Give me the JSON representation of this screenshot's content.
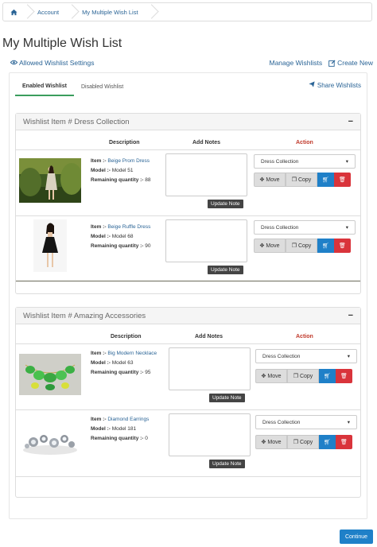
{
  "breadcrumb": {
    "items": [
      "Account",
      "My Multiple Wish List"
    ]
  },
  "page_title": "My Multiple Wish List",
  "settings_link": "Allowed Wishlist Settings",
  "top_links": {
    "manage": "Manage Wishlists",
    "create": "Create New"
  },
  "tabs": [
    {
      "label": "Enabled Wishlist",
      "active": true
    },
    {
      "label": "Disabled Wishlist",
      "active": false
    }
  ],
  "share_label": "Share Wishlists",
  "panels": [
    {
      "title": "Wishlist Item # Dress Collection",
      "toggle": "−",
      "columns": {
        "description": "Description",
        "notes": "Add Notes",
        "action": "Action"
      },
      "items": [
        {
          "item_label": "Item :-",
          "name": "Beige Prom Dress",
          "model_label": "Model :-",
          "model": "Model 51",
          "qty_label": "Remaining quantity :-",
          "qty": "88",
          "select": "Dress Collection",
          "update": "Update Note",
          "move": "Move",
          "copy": "Copy"
        },
        {
          "item_label": "Item :-",
          "name": "Beige Ruffle Dress",
          "model_label": "Model :-",
          "model": "Model 68",
          "qty_label": "Remaining quantity :-",
          "qty": "90",
          "select": "Dress Collection",
          "update": "Update Note",
          "move": "Move",
          "copy": "Copy"
        }
      ]
    },
    {
      "title": "Wishlist Item # Amazing Accessories",
      "toggle": "−",
      "columns": {
        "description": "Description",
        "notes": "Add Notes",
        "action": "Action"
      },
      "items": [
        {
          "item_label": "Item :-",
          "name": "Big Modern Necklace",
          "model_label": "Model :-",
          "model": "Model 63",
          "qty_label": "Remaining quantity :-",
          "qty": "95",
          "select": "Dress Collection",
          "update": "Update Note",
          "move": "Move",
          "copy": "Copy"
        },
        {
          "item_label": "Item :-",
          "name": "Diamond Earrings",
          "model_label": "Model :-",
          "model": "Model 181",
          "qty_label": "Remaining quantity :-",
          "qty": "0",
          "select": "Dress Collection",
          "update": "Update Note",
          "move": "Move",
          "copy": "Copy"
        }
      ]
    }
  ],
  "continue_label": "Continue",
  "colors": {
    "link": "#2a6496",
    "primary": "#1f80c8",
    "danger": "#d9343b",
    "action_header": "#c0392b",
    "tab_underline": "#3a9d5d"
  }
}
